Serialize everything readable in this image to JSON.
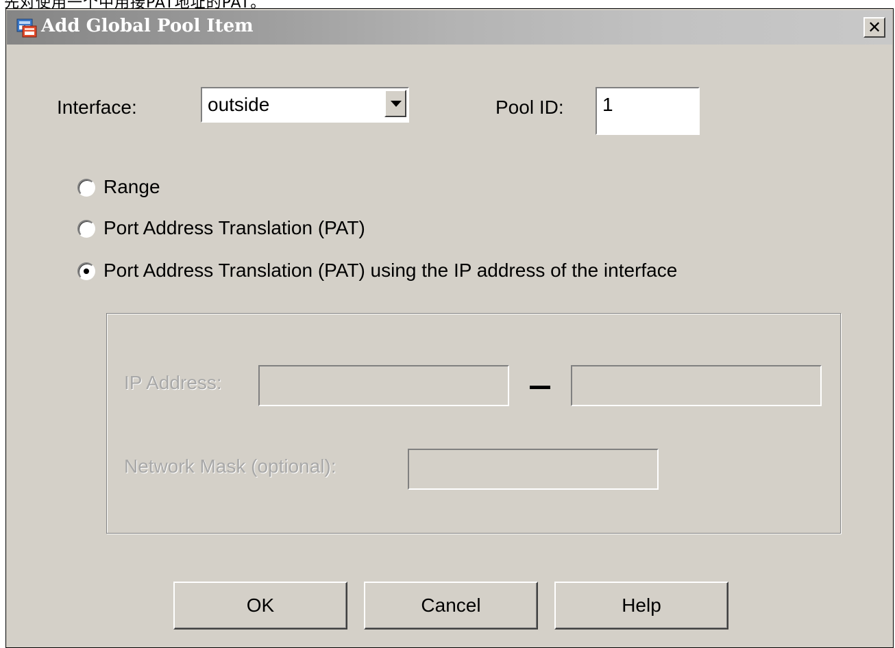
{
  "caption": {
    "text": "先对使用一个中用接PAT地址的PAT。"
  },
  "window": {
    "title": "Add Global Pool Item",
    "close_glyph": "✕",
    "icon": "app-icon"
  },
  "form": {
    "interface_label": "Interface:",
    "interface_value": "outside",
    "pool_id_label": "Pool ID:",
    "pool_id_value": "1"
  },
  "translation_options": [
    {
      "label": "Range",
      "checked": false
    },
    {
      "label": "Port Address Translation (PAT)",
      "checked": false
    },
    {
      "label": "Port Address Translation (PAT) using the IP address of the interface",
      "checked": true
    }
  ],
  "address_group": {
    "enabled": false,
    "ip_address_label": "IP Address:",
    "range_separator": "–",
    "ip_start_value": "",
    "ip_end_value": "",
    "network_mask_label": "Network Mask (optional):",
    "network_mask_value": ""
  },
  "buttons": {
    "ok": "OK",
    "cancel": "Cancel",
    "help": "Help"
  },
  "colors": {
    "dialog_bg": "#d4d0c8",
    "title_text": "#ffffff",
    "disabled_text": "#a8a8a8"
  }
}
